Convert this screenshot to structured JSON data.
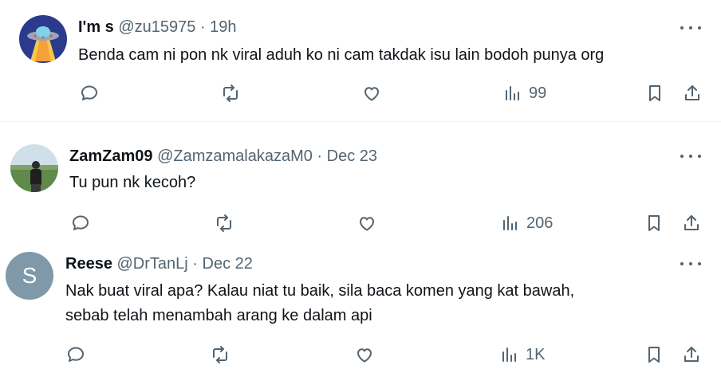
{
  "tweets": [
    {
      "name": "I'm s",
      "handle": "@zu15975",
      "time": "19h",
      "lines": [
        "Benda cam ni pon nk viral aduh ko ni cam takdak isu lain bodoh punya org"
      ],
      "views": "99"
    },
    {
      "name": "ZamZam09",
      "handle": "@ZamzamalakazaM0",
      "time": "Dec 23",
      "lines": [
        "Tu pun nk kecoh?"
      ],
      "views": "206"
    },
    {
      "name": "Reese",
      "handle": "@DrTanLj",
      "time": "Dec 22",
      "avatar_letter": "S",
      "lines": [
        "Nak buat viral apa? Kalau niat tu baik, sila baca komen yang kat bawah,",
        "sebab telah menambah arang ke dalam api"
      ],
      "views": "1K"
    }
  ],
  "separator": " · ",
  "colors": {
    "text": "#0f1419",
    "muted": "#536471",
    "avatar_grey": "#7f99a9"
  }
}
